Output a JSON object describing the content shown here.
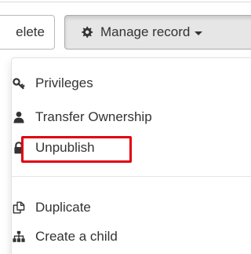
{
  "toolbar": {
    "delete_label": "elete",
    "manage_label": "Manage record",
    "manage_icon": "gear-icon"
  },
  "menu": {
    "items": [
      {
        "label": "Privileges",
        "icon": "key-icon"
      },
      {
        "label": "Transfer Ownership",
        "icon": "user-icon"
      },
      {
        "label": "Unpublish",
        "icon": "lock-icon",
        "highlighted": true
      },
      {
        "label": "Duplicate",
        "icon": "copy-icon"
      },
      {
        "label": "Create a child",
        "icon": "sitemap-icon"
      }
    ]
  },
  "colors": {
    "highlight_border": "#e0000f",
    "text": "#333333",
    "active_button_bg": "#e6e6e6"
  }
}
